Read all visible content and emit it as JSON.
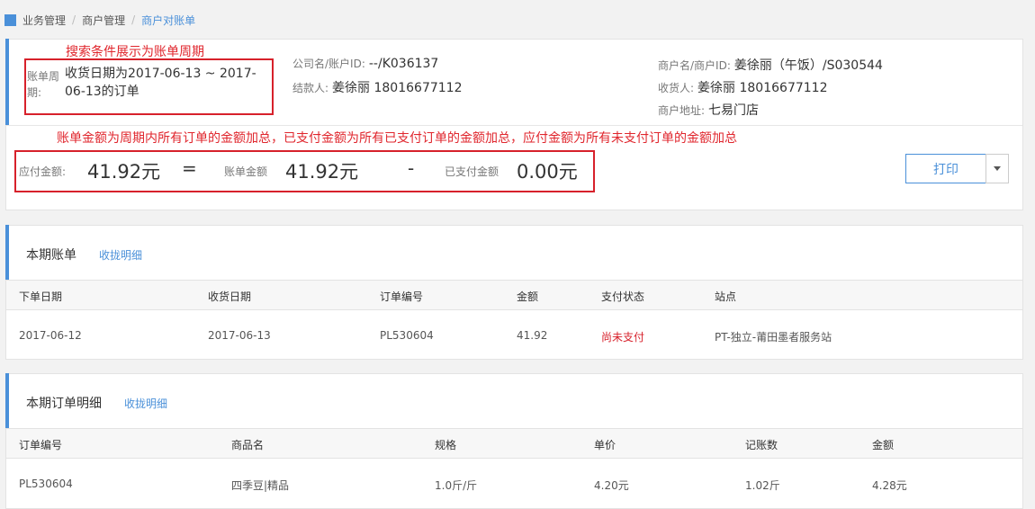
{
  "breadcrumb": [
    "业务管理",
    "商户管理",
    "商户对账单"
  ],
  "annotations": {
    "cycle_note": "搜索条件展示为账单周期",
    "amount_note": "账单金额为周期内所有订单的金额加总，已支付金额为所有已支付订单的金额加总，应付金额为所有未支付订单的金额加总"
  },
  "info": {
    "cycle_label": "账单周期:",
    "cycle_value": "收货日期为2017-06-13 ~ 2017-06-13的订单",
    "company_label": "公司名/账户ID:",
    "company_value": "--/K036137",
    "payee_label": "结款人:",
    "payee_value": "姜徐丽 18016677112",
    "merchant_label": "商户名/商户ID:",
    "merchant_value": "姜徐丽（午饭）/S030544",
    "receiver_label": "收货人:",
    "receiver_value": "姜徐丽 18016677112",
    "address_label": "商户地址:",
    "address_value": "七易门店"
  },
  "amounts": {
    "payable_label": "应付金额:",
    "payable_value": "41.92元",
    "equals": "=",
    "bill_label": "账单金额",
    "bill_value": "41.92元",
    "minus": "-",
    "paid_label": "已支付金额",
    "paid_value": "0.00元"
  },
  "actions": {
    "print_label": "打印"
  },
  "bill_section": {
    "title": "本期账单",
    "toggle": "收拢明细",
    "columns": [
      "下单日期",
      "收货日期",
      "订单编号",
      "金额",
      "支付状态",
      "站点"
    ],
    "rows": [
      [
        "2017-06-12",
        "2017-06-13",
        "PL530604",
        "41.92",
        "尚未支付",
        "PT-独立-莆田墨者服务站"
      ]
    ]
  },
  "order_section": {
    "title": "本期订单明细",
    "toggle": "收拢明细",
    "columns": [
      "订单编号",
      "商品名",
      "规格",
      "单价",
      "记账数",
      "金额"
    ],
    "rows": [
      [
        "PL530604",
        "四季豆|精品",
        "1.0斤/斤",
        "4.20元",
        "1.02斤",
        "4.28元"
      ]
    ]
  },
  "colors": {
    "accent": "#4a90d9",
    "alert": "#d7212b"
  }
}
